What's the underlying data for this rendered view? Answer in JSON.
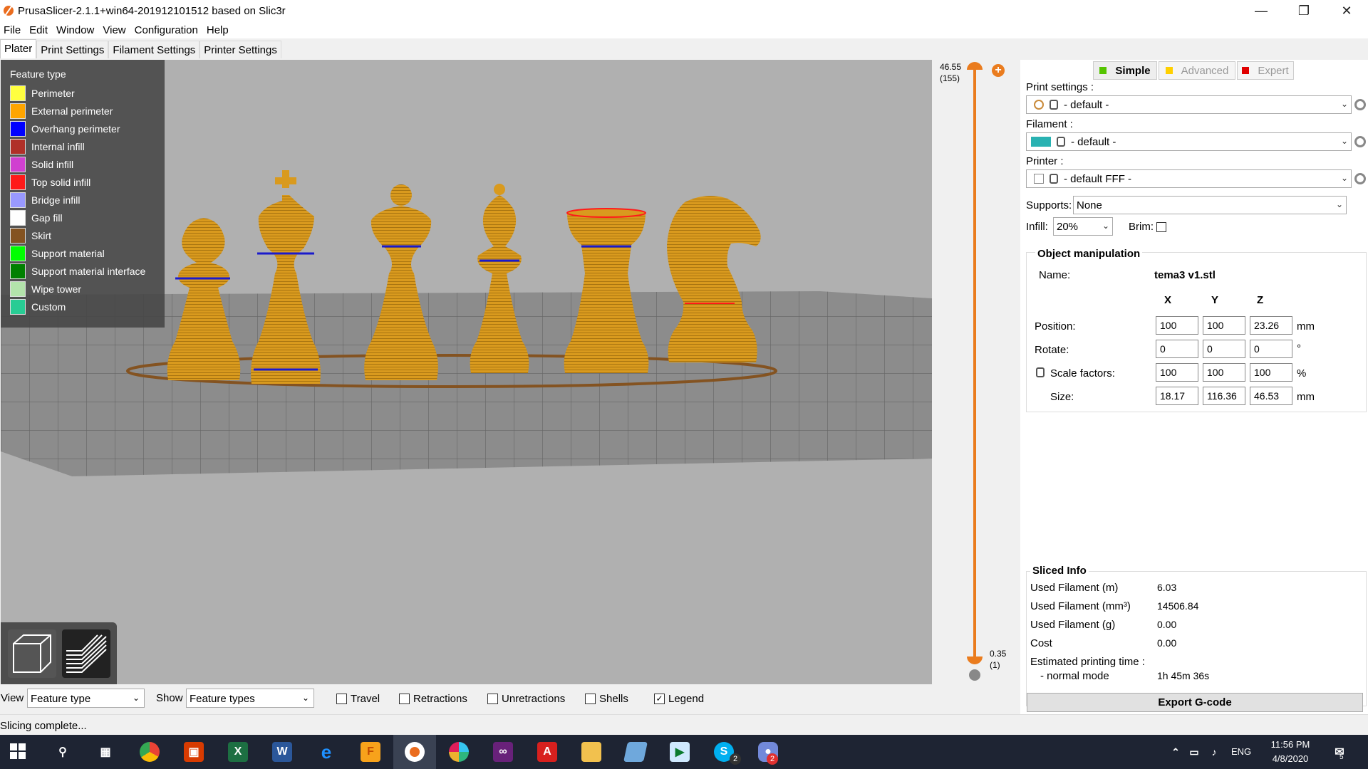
{
  "window": {
    "title": "PrusaSlicer-2.1.1+win64-201912101512 based on Slic3r"
  },
  "menu": [
    "File",
    "Edit",
    "Window",
    "View",
    "Configuration",
    "Help"
  ],
  "tabs": [
    "Plater",
    "Print Settings",
    "Filament Settings",
    "Printer Settings"
  ],
  "legend": {
    "title": "Feature type",
    "items": [
      {
        "label": "Perimeter",
        "color": "#ffff40"
      },
      {
        "label": "External perimeter",
        "color": "#ffa500"
      },
      {
        "label": "Overhang perimeter",
        "color": "#0000ff"
      },
      {
        "label": "Internal infill",
        "color": "#b03029"
      },
      {
        "label": "Solid infill",
        "color": "#d040d0"
      },
      {
        "label": "Top solid infill",
        "color": "#ff1a1a"
      },
      {
        "label": "Bridge infill",
        "color": "#9999ff"
      },
      {
        "label": "Gap fill",
        "color": "#ffffff"
      },
      {
        "label": "Skirt",
        "color": "#845321"
      },
      {
        "label": "Support material",
        "color": "#00ff00"
      },
      {
        "label": "Support material interface",
        "color": "#008000"
      },
      {
        "label": "Wipe tower",
        "color": "#b3e3ab"
      },
      {
        "label": "Custom",
        "color": "#28cc94"
      }
    ]
  },
  "layer_slider": {
    "top_value": "46.55",
    "top_layer": "(155)",
    "bottom_value": "0.35",
    "bottom_layer": "(1)"
  },
  "modes": [
    {
      "label": "Simple",
      "color": "#55c400",
      "active": true
    },
    {
      "label": "Advanced",
      "color": "#ffd000",
      "active": false
    },
    {
      "label": "Expert",
      "color": "#e00000",
      "active": false
    }
  ],
  "presets": {
    "print_label": "Print settings :",
    "print_value": "- default -",
    "filament_label": "Filament :",
    "filament_value": "- default -",
    "filament_color": "#29b2b2",
    "printer_label": "Printer :",
    "printer_value": "- default FFF -",
    "supports_label": "Supports:",
    "supports_value": "None",
    "infill_label": "Infill:",
    "infill_value": "20%",
    "brim_label": "Brim:"
  },
  "object_manipulation": {
    "title": "Object manipulation",
    "name_label": "Name:",
    "name_value": "tema3 v1.stl",
    "axis_x": "X",
    "axis_y": "Y",
    "axis_z": "Z",
    "position_label": "Position:",
    "position": [
      "100",
      "100",
      "23.26"
    ],
    "position_unit": "mm",
    "rotate_label": "Rotate:",
    "rotate": [
      "0",
      "0",
      "0"
    ],
    "rotate_unit": "°",
    "scale_label": "Scale factors:",
    "scale": [
      "100",
      "100",
      "100"
    ],
    "scale_unit": "%",
    "size_label": "Size:",
    "size": [
      "18.17",
      "116.36",
      "46.53"
    ],
    "size_unit": "mm"
  },
  "sliced_info": {
    "title": "Sliced Info",
    "rows": [
      {
        "label": "Used Filament (m)",
        "value": "6.03"
      },
      {
        "label": "Used Filament (mm³)",
        "value": "14506.84"
      },
      {
        "label": "Used Filament (g)",
        "value": "0.00"
      },
      {
        "label": "Cost",
        "value": "0.00"
      }
    ],
    "time_label": "Estimated printing time :",
    "mode_label": "- normal mode",
    "mode_value": "1h 45m 36s"
  },
  "export_label": "Export G-code",
  "bottom_bar": {
    "view_label": "View",
    "view_value": "Feature type",
    "show_label": "Show",
    "show_value": "Feature types",
    "checks": [
      {
        "label": "Travel",
        "checked": ""
      },
      {
        "label": "Retractions",
        "checked": ""
      },
      {
        "label": "Unretractions",
        "checked": ""
      },
      {
        "label": "Shells",
        "checked": ""
      },
      {
        "label": "Legend",
        "checked": "✓"
      }
    ]
  },
  "status": "Slicing complete...",
  "taskbar": {
    "lang": "ENG",
    "time": "11:56 PM",
    "date": "4/8/2020",
    "skype_badge": "2",
    "discord_badge": "2",
    "notif_count": "5"
  }
}
